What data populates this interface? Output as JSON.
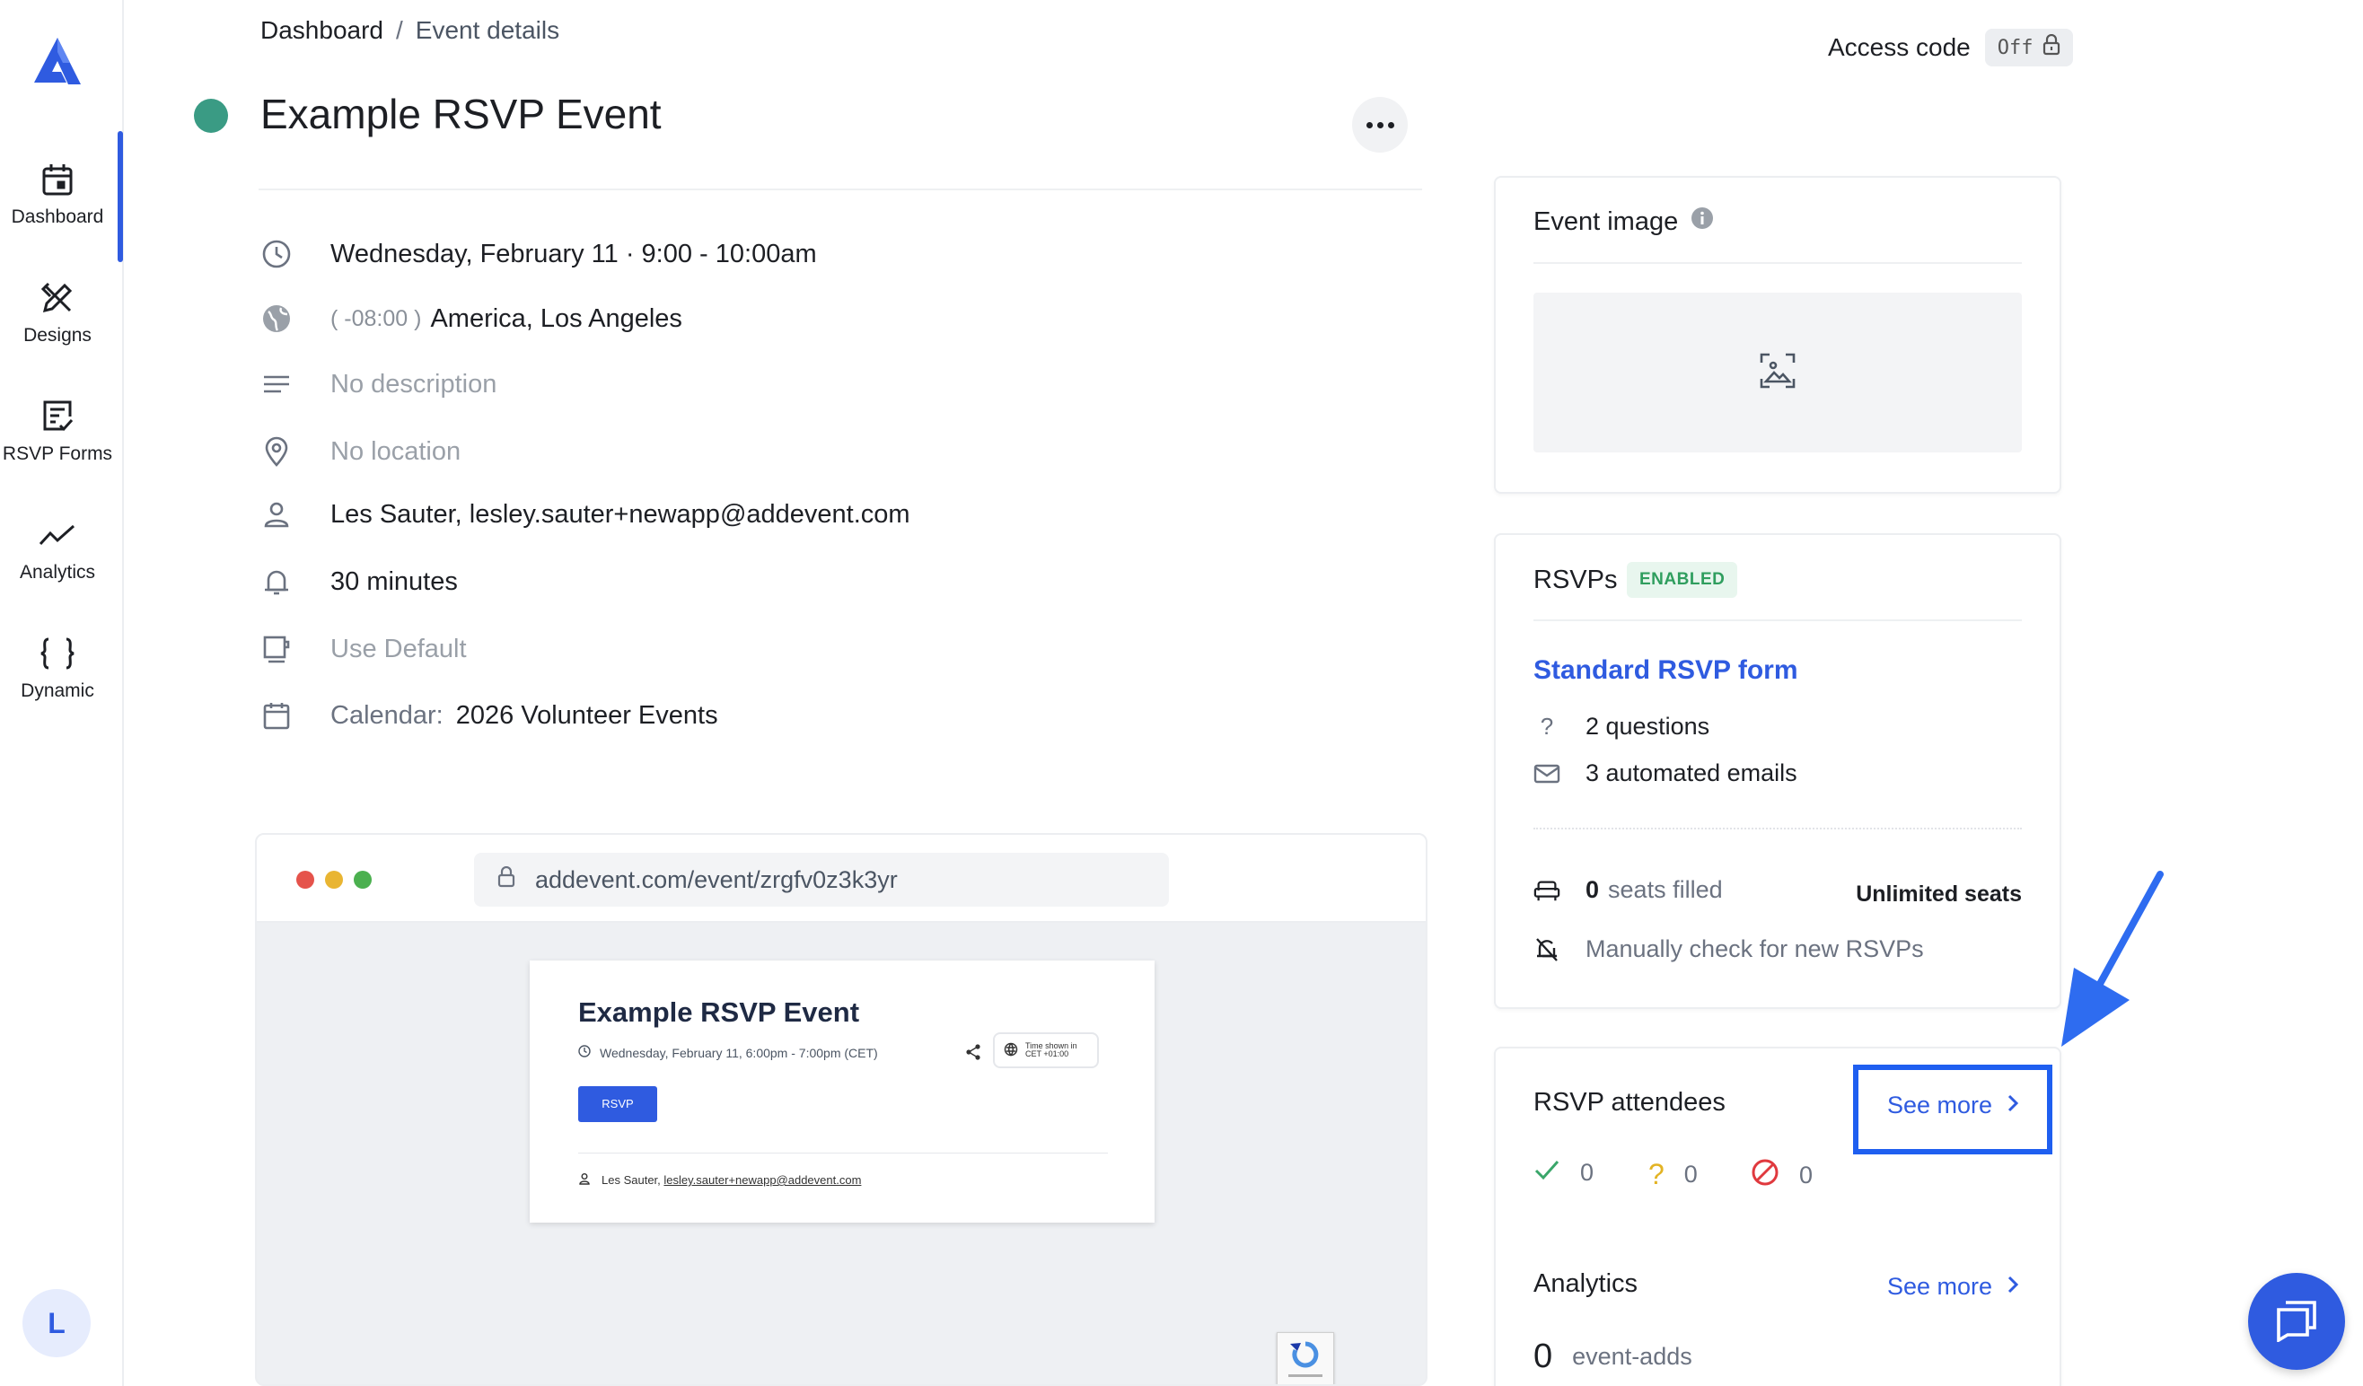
{
  "sidebar": {
    "items": [
      {
        "label": "Dashboard",
        "icon": "calendar-icon"
      },
      {
        "label": "Designs",
        "icon": "pencil-ruler-icon"
      },
      {
        "label": "RSVP Forms",
        "icon": "form-check-icon"
      },
      {
        "label": "Analytics",
        "icon": "trend-line-icon"
      },
      {
        "label": "Dynamic",
        "icon": "curly-braces-icon"
      }
    ],
    "avatar": "L"
  },
  "breadcrumb": {
    "root": "Dashboard",
    "separator": "/",
    "current": "Event details"
  },
  "access_code": {
    "label": "Access code",
    "value": "Off"
  },
  "event": {
    "title": "Example RSVP Event",
    "status_color": "#3a9b84",
    "datetime": "Wednesday, February 11 · 9:00 - 10:00am",
    "tz_offset": "( -08:00 )",
    "timezone": "America, Los Angeles",
    "description": "No description",
    "location": "No location",
    "organizer": "Les Sauter, lesley.sauter+newapp@addevent.com",
    "reminder": "30 minutes",
    "template": "Use Default",
    "calendar_label": "Calendar:",
    "calendar": "2026 Volunteer Events"
  },
  "preview": {
    "url": "addevent.com/event/zrgfv0z3k3yr",
    "title": "Example RSVP Event",
    "date": "Wednesday, February 11, 6:00pm - 7:00pm (CET)",
    "tz_line1": "Time shown in",
    "tz_line2": "CET +01:00",
    "button": "RSVP",
    "host_name": "Les Sauter,",
    "host_email": "lesley.sauter+newapp@addevent.com"
  },
  "event_image": {
    "title": "Event image"
  },
  "rsvps": {
    "title": "RSVPs",
    "badge": "ENABLED",
    "form_link": "Standard RSVP form",
    "questions": "2 questions",
    "emails": "3 automated emails",
    "seats_count": "0",
    "seats_label": "seats filled",
    "seats_limit": "Unlimited seats",
    "check_note": "Manually check for new RSVPs"
  },
  "attendees": {
    "title": "RSVP attendees",
    "see_more": "See more",
    "yes_count": "0",
    "maybe_count": "0",
    "no_count": "0"
  },
  "analytics": {
    "title": "Analytics",
    "see_more": "See more",
    "count": "0",
    "label": "event-adds"
  },
  "colors": {
    "accent": "#2f5be0",
    "highlight": "#1f5ff0",
    "success": "#3a9b84"
  }
}
